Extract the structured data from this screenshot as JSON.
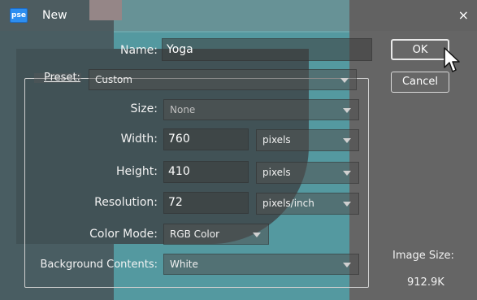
{
  "window": {
    "app_icon_text": "pse",
    "title": "New",
    "close_glyph": "×"
  },
  "form": {
    "name_label": "Name:",
    "name_value": "Yoga",
    "preset_label": "Preset:",
    "preset_value": "Custom",
    "size_label": "Size:",
    "size_value": "None",
    "width_label": "Width:",
    "width_value": "760",
    "width_unit": "pixels",
    "height_label": "Height:",
    "height_value": "410",
    "height_unit": "pixels",
    "resolution_label": "Resolution:",
    "resolution_value": "72",
    "resolution_unit": "pixels/inch",
    "color_mode_label": "Color Mode:",
    "color_mode_value": "RGB Color",
    "background_label": "Background Contents:",
    "background_value": "White"
  },
  "buttons": {
    "ok": "OK",
    "cancel": "Cancel"
  },
  "image_size": {
    "label": "Image Size:",
    "value": "912.9K"
  },
  "icons": {
    "app": "app-icon",
    "close": "close-icon",
    "dropdown": "chevron-down-icon",
    "cursor": "cursor-icon"
  }
}
